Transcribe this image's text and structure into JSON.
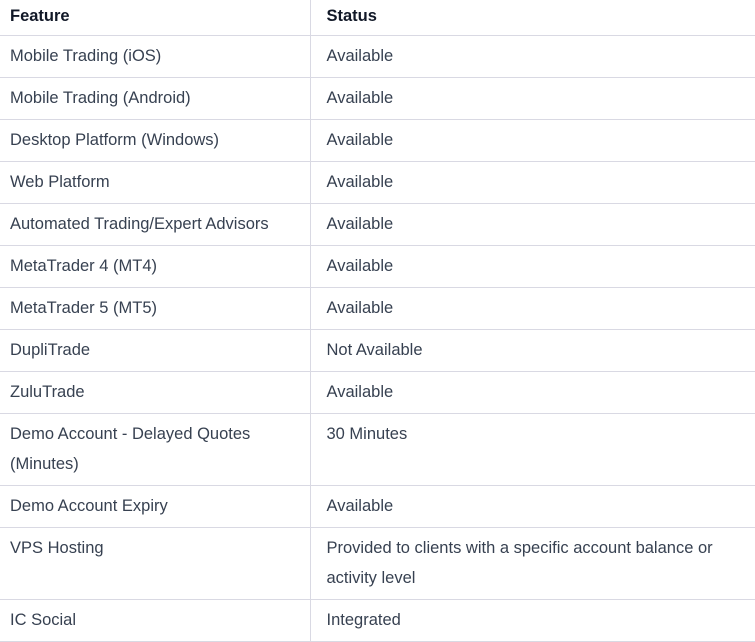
{
  "table": {
    "headers": [
      "Feature",
      "Status"
    ],
    "rows": [
      {
        "feature": "Mobile Trading (iOS)",
        "status": "Available"
      },
      {
        "feature": "Mobile Trading (Android)",
        "status": "Available"
      },
      {
        "feature": "Desktop Platform (Windows)",
        "status": "Available"
      },
      {
        "feature": "Web Platform",
        "status": "Available"
      },
      {
        "feature": "Automated Trading/Expert Advisors",
        "status": "Available"
      },
      {
        "feature": "MetaTrader 4 (MT4)",
        "status": "Available"
      },
      {
        "feature": "MetaTrader 5 (MT5)",
        "status": "Available"
      },
      {
        "feature": "DupliTrade",
        "status": "Not Available"
      },
      {
        "feature": "ZuluTrade",
        "status": "Available"
      },
      {
        "feature": "Demo Account - Delayed Quotes (Minutes)",
        "status": "30 Minutes"
      },
      {
        "feature": "Demo Account Expiry",
        "status": "Available"
      },
      {
        "feature": "VPS Hosting",
        "status": "Provided to clients with a specific account balance or activity level"
      },
      {
        "feature": "IC Social",
        "status": "Integrated"
      }
    ]
  }
}
